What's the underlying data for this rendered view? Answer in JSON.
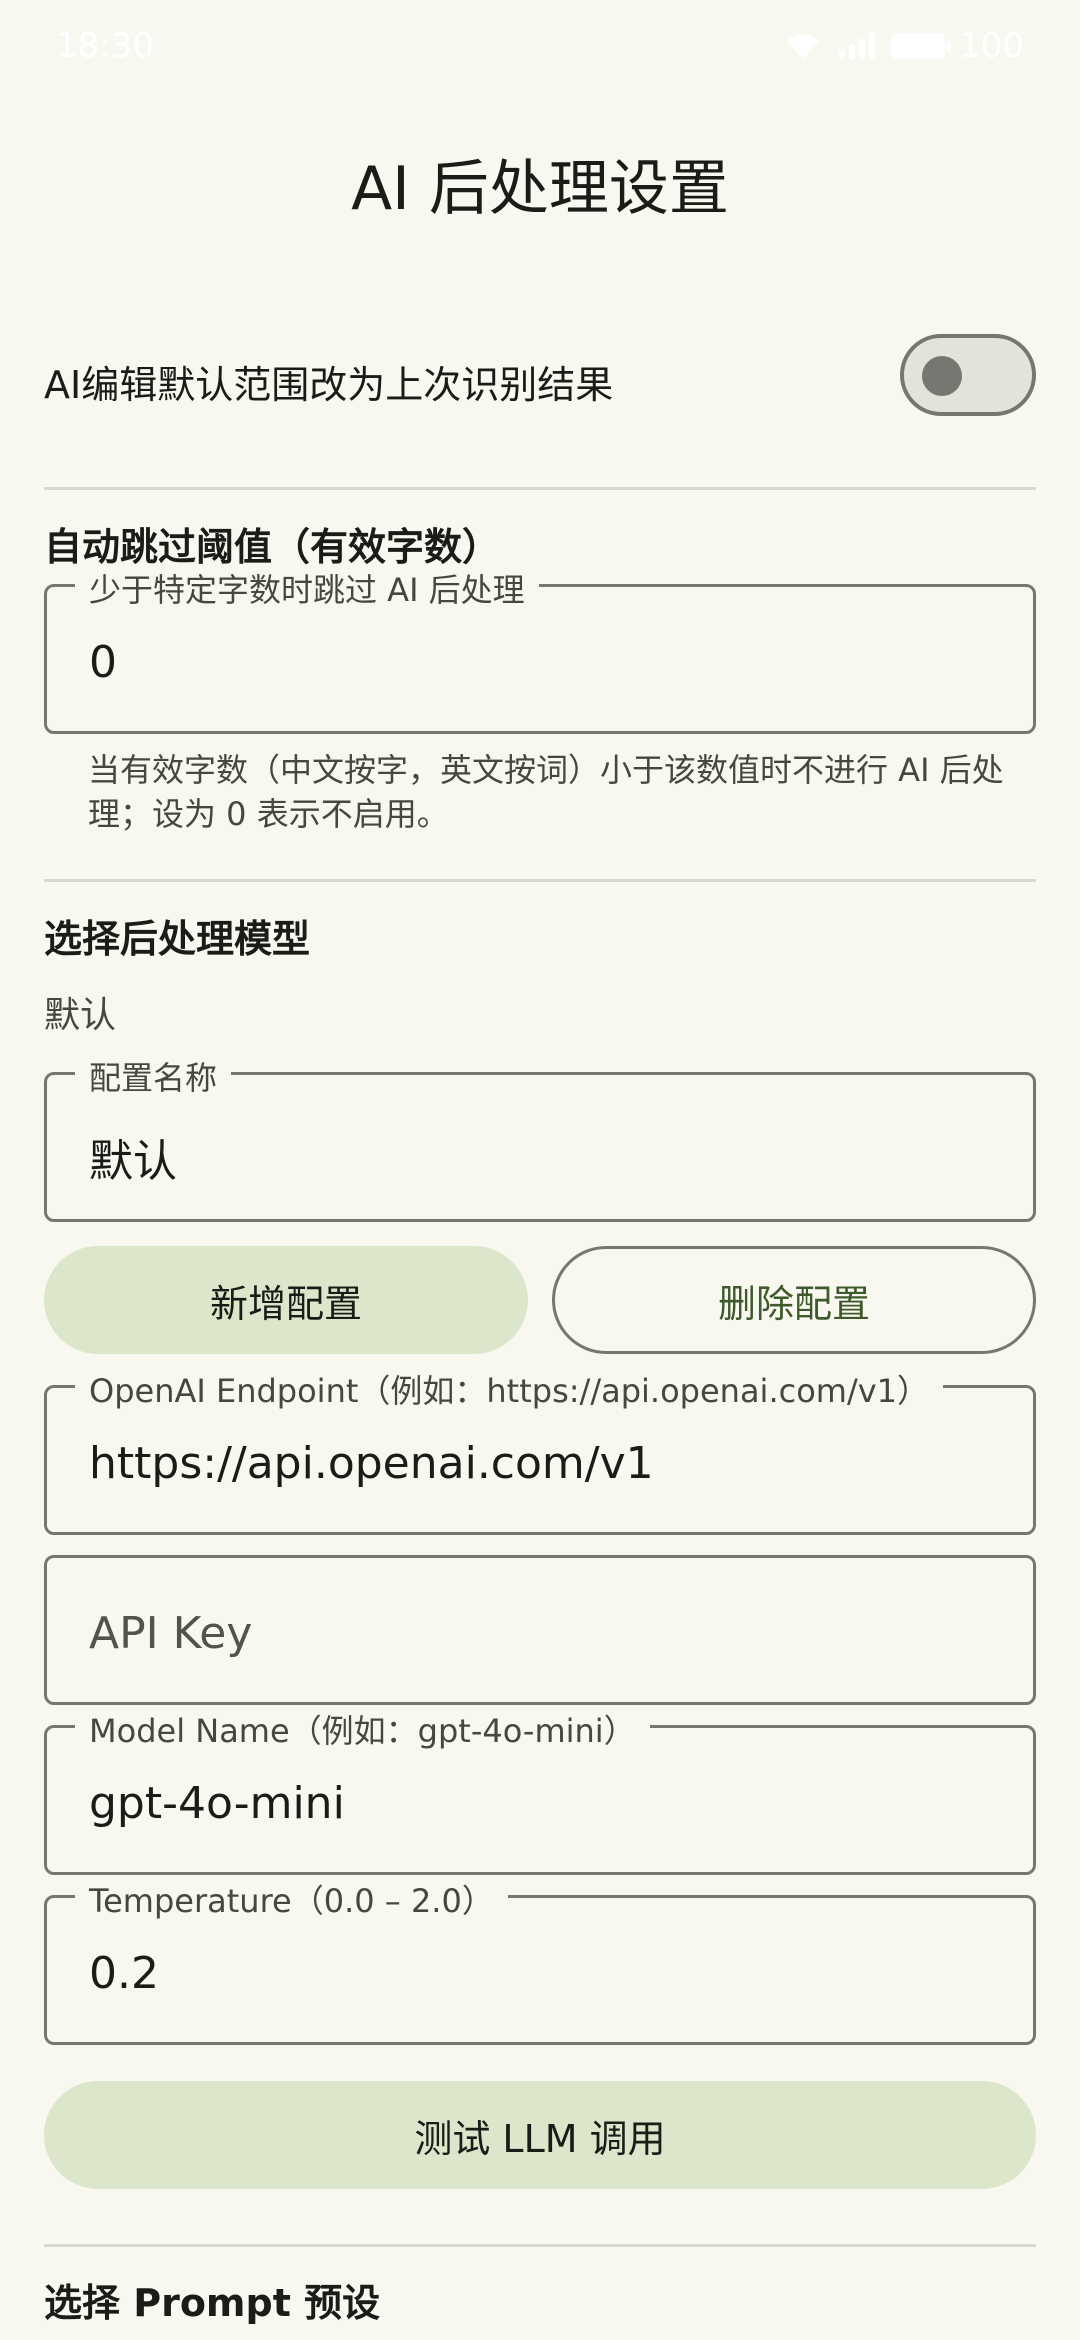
{
  "status_bar": {
    "time": "18:30",
    "battery": "100"
  },
  "title": "AI 后处理设置",
  "switch_row": {
    "label": "AI编辑默认范围改为上次识别结果",
    "enabled": false
  },
  "threshold_section": {
    "title": "自动跳过阈值（有效字数）",
    "field_label": "少于特定字数时跳过 AI 后处理",
    "field_value": "0",
    "helper": "当有效字数（中文按字，英文按词）小于该数值时不进行 AI 后处理；设为 0 表示不启用。"
  },
  "model_section": {
    "title": "选择后处理模型",
    "selected": "默认",
    "config_name_label": "配置名称",
    "config_name_value": "默认",
    "add_button": "新增配置",
    "delete_button": "删除配置",
    "endpoint_label": "OpenAI Endpoint（例如：https://api.openai.com/v1）",
    "endpoint_value": "https://api.openai.com/v1",
    "api_key_placeholder": "API Key",
    "model_label": "Model Name（例如：gpt-4o-mini）",
    "model_value": "gpt-4o-mini",
    "temperature_label": "Temperature（0.0 – 2.0）",
    "temperature_value": "0.2",
    "test_button": "测试 LLM 调用"
  },
  "prompt_section": {
    "title": "选择 Prompt 预设"
  }
}
